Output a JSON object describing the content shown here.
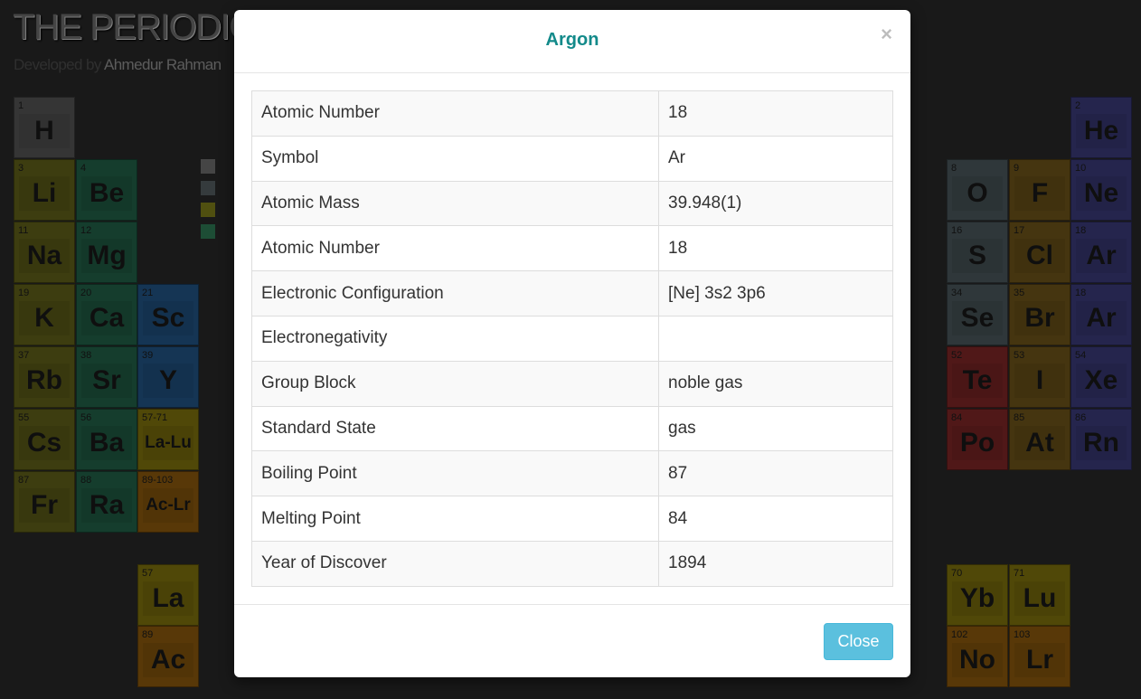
{
  "background": {
    "title": "THE PERIODIC",
    "developed_by_prefix": "Developed by",
    "developer": "Ahmedur Rahman"
  },
  "colors": {
    "accent": "#138a8a",
    "close_button": "#5bc0de",
    "alkali": "#7a7a20",
    "alkaline": "#2a7a5a",
    "transition": "#2a6aa8",
    "metalloid": "#5e6e74",
    "nonmetal": "#6a6a6a",
    "halogen": "#8a6a20",
    "noble": "#4a4a9a",
    "lanthanide": "#a09010",
    "actinide": "#b07010",
    "post_transition": "#a03030"
  },
  "elements": [
    {
      "num": "1",
      "sym": "H"
    },
    {
      "num": "2",
      "sym": "He"
    },
    {
      "num": "3",
      "sym": "Li"
    },
    {
      "num": "4",
      "sym": "Be"
    },
    {
      "num": "8",
      "sym": "O"
    },
    {
      "num": "9",
      "sym": "F"
    },
    {
      "num": "10",
      "sym": "Ne"
    },
    {
      "num": "11",
      "sym": "Na"
    },
    {
      "num": "12",
      "sym": "Mg"
    },
    {
      "num": "16",
      "sym": "S"
    },
    {
      "num": "17",
      "sym": "Cl"
    },
    {
      "num": "18",
      "sym": "Ar"
    },
    {
      "num": "19",
      "sym": "K"
    },
    {
      "num": "20",
      "sym": "Ca"
    },
    {
      "num": "21",
      "sym": "Sc"
    },
    {
      "num": "34",
      "sym": "Se"
    },
    {
      "num": "35",
      "sym": "Br"
    },
    {
      "num": "18",
      "sym": "Ar"
    },
    {
      "num": "37",
      "sym": "Rb"
    },
    {
      "num": "38",
      "sym": "Sr"
    },
    {
      "num": "39",
      "sym": "Y"
    },
    {
      "num": "52",
      "sym": "Te"
    },
    {
      "num": "53",
      "sym": "I"
    },
    {
      "num": "54",
      "sym": "Xe"
    },
    {
      "num": "55",
      "sym": "Cs"
    },
    {
      "num": "56",
      "sym": "Ba"
    },
    {
      "num": "57-71",
      "sym": "La-Lu"
    },
    {
      "num": "84",
      "sym": "Po"
    },
    {
      "num": "85",
      "sym": "At"
    },
    {
      "num": "86",
      "sym": "Rn"
    },
    {
      "num": "87",
      "sym": "Fr"
    },
    {
      "num": "88",
      "sym": "Ra"
    },
    {
      "num": "89-103",
      "sym": "Ac-Lr"
    },
    {
      "num": "57",
      "sym": "La"
    },
    {
      "num": "70",
      "sym": "Yb"
    },
    {
      "num": "71",
      "sym": "Lu"
    },
    {
      "num": "89",
      "sym": "Ac"
    },
    {
      "num": "102",
      "sym": "No"
    },
    {
      "num": "103",
      "sym": "Lr"
    }
  ],
  "modal": {
    "title": "Argon",
    "close_icon": "×",
    "rows": [
      {
        "label": "Atomic Number",
        "value": "18"
      },
      {
        "label": "Symbol",
        "value": "Ar"
      },
      {
        "label": "Atomic Mass",
        "value": "39.948(1)"
      },
      {
        "label": "Atomic Number",
        "value": "18"
      },
      {
        "label": "Electronic Configuration",
        "value": "[Ne] 3s2 3p6"
      },
      {
        "label": "Electronegativity",
        "value": ""
      },
      {
        "label": "Group Block",
        "value": "noble gas"
      },
      {
        "label": "Standard State",
        "value": "gas"
      },
      {
        "label": "Boiling Point",
        "value": "87"
      },
      {
        "label": "Melting Point",
        "value": "84"
      },
      {
        "label": "Year of Discover",
        "value": "1894"
      }
    ],
    "close_button_label": "Close"
  }
}
